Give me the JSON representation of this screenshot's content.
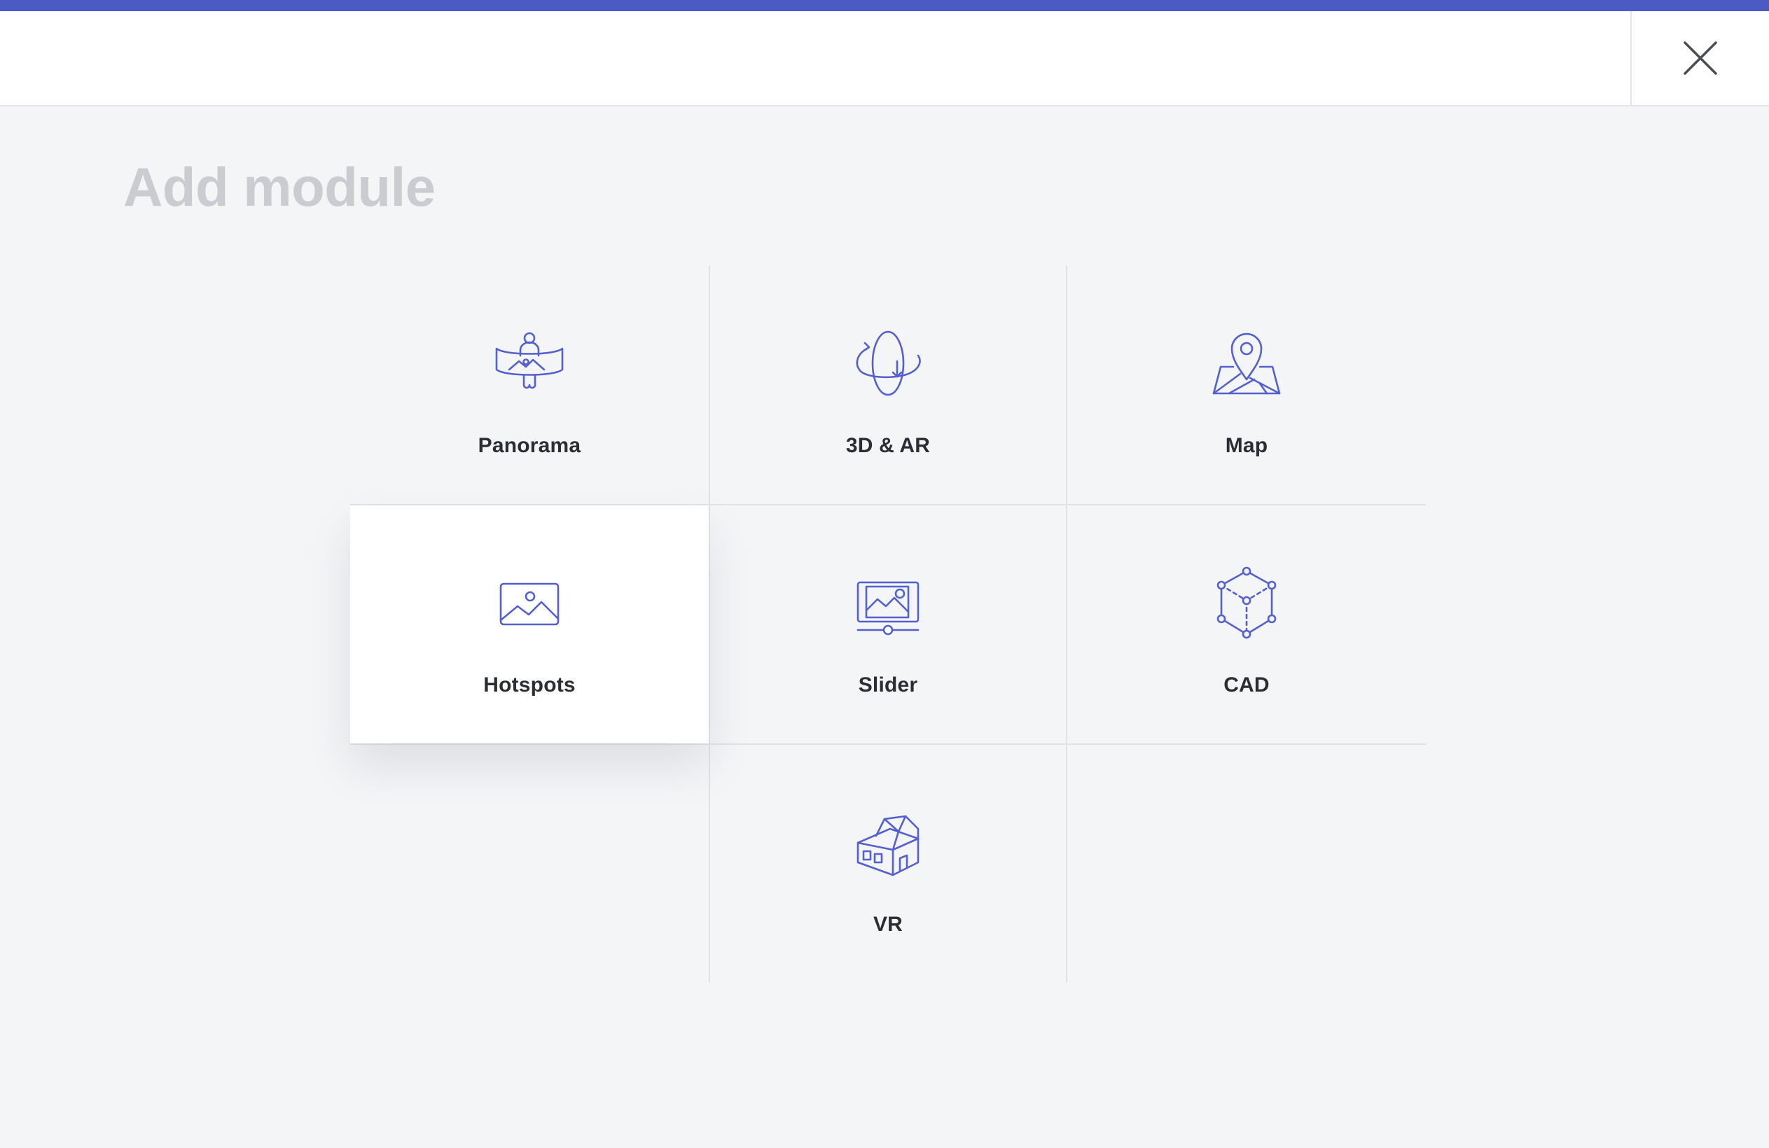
{
  "header": {
    "close_icon": "close-icon"
  },
  "page": {
    "title": "Add module"
  },
  "modules": [
    {
      "label": "Panorama",
      "icon": "panorama-icon"
    },
    {
      "label": "3D & AR",
      "icon": "3d-ar-icon"
    },
    {
      "label": "Map",
      "icon": "map-pin-icon"
    },
    {
      "label": "Hotspots",
      "icon": "image-icon"
    },
    {
      "label": "Slider",
      "icon": "slider-icon"
    },
    {
      "label": "CAD",
      "icon": "cube-icon"
    },
    {
      "label": "VR",
      "icon": "house-icon"
    }
  ],
  "selected_module": "Hotspots",
  "colors": {
    "accent": "#4c5bc4",
    "icon": "#5560d0",
    "title": "#cbccd2",
    "label": "#2a2d33",
    "background": "#f4f5f7"
  }
}
